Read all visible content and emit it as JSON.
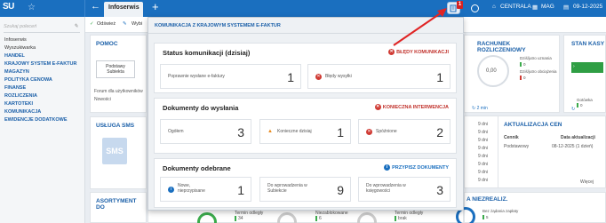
{
  "topbar": {
    "logo": "SU",
    "active_tab": "Infoserwis",
    "notification_count": "1",
    "company": "CENTRALA",
    "warehouse": "MAG",
    "date": "09-12-2025"
  },
  "sidebar": {
    "search_placeholder": "Szukaj poleceń",
    "items": [
      {
        "label": "Infoserwis"
      },
      {
        "label": "Wyszukiwarka"
      },
      {
        "label": "HANDEL"
      },
      {
        "label": "KRAJOWY SYSTEM E-FAKTUR"
      },
      {
        "label": "MAGAZYN"
      },
      {
        "label": "POLITYKA CENOWA"
      },
      {
        "label": "FINANSE"
      },
      {
        "label": "ROZLICZENIA"
      },
      {
        "label": "KARTOTEKI"
      },
      {
        "label": "KOMUNIKACJA"
      },
      {
        "label": "EWIDENCJE DODATKOWE"
      }
    ]
  },
  "toolbar": {
    "refresh": "Odśwież",
    "choose": "Wybi"
  },
  "tiles": {
    "pomoc_title": "POMOC",
    "pomoc_btn": "Podstawy Subiekta",
    "forum": "Forum dla użytkowników",
    "nowosci": "Nowości",
    "sms_title": "USŁUGA SMS",
    "sms_icon": "SMS",
    "asortyment": "ASORTYMENT DO",
    "rachunek_title": "RACHUNEK ROZLICZENIOWY",
    "rachunek_val": "0,00",
    "doliczenie_uznania": "Dziś/jutro uznania",
    "doliczenie_obciazenia": "Dziś/jutro obciążenia",
    "zero_a": "0",
    "zero_b": "0",
    "min_label": "2 min",
    "stan_title": "STAN KASY",
    "gotowka": "Gotówka",
    "gotowka_val": "0",
    "aktualizacja_title": "AKTUALIZACJA CEN",
    "cennik": "Cennik",
    "data_aktualizacji": "Data aktualizacji",
    "podstawowy": "Podstawowy",
    "data_val": "08-12-2025 (1 dzień)",
    "wiecej": "Więcej",
    "dni": [
      "9 dni",
      "9 dni",
      "9 dni",
      "9 dni",
      "9 dni",
      "9 dni",
      "9 dni",
      "9 dni"
    ],
    "niezrealiz": "A NIEZREALIZ.",
    "bez_zadania": "Bez żądania zapłaty",
    "bez_val": "5",
    "termin_a": "Termin odległy",
    "termin_a_val": "34",
    "niezablokowane": "Niezablokowane",
    "niezablokowane_val": "6",
    "termin_b": "Termin odległy",
    "brak": "brak",
    "wiecej_c": "Więc"
  },
  "modal": {
    "title": "KOMUNIKACJA Z KRAJOWYM SYSTEMEM E-FAKTUR",
    "status": {
      "title": "Status komunikacji (dzisiaj)",
      "flag": "BŁĘDY KOMUNIKACJI",
      "cells": [
        {
          "label": "Poprawnie wysłane e-faktury",
          "value": "1"
        },
        {
          "label": "Błędy wysyłki",
          "value": "1"
        }
      ]
    },
    "to_send": {
      "title": "Dokumenty do wysłania",
      "flag": "KONIECZNA INTERWENCJA",
      "cells": [
        {
          "label": "Ogółem",
          "value": "3"
        },
        {
          "label": "Konieczne dzisiaj",
          "value": "1"
        },
        {
          "label": "Spóźnione",
          "value": "2"
        }
      ]
    },
    "received": {
      "title": "Dokumenty odebrane",
      "flag": "PRZYPISZ DOKUMENTY",
      "cells": [
        {
          "label": "Nowe, nieprzypisane",
          "value": "1"
        },
        {
          "label": "Do wprowadzenia w Subiekcie",
          "value": "9"
        },
        {
          "label": "Do wprowadzenia w księgowości",
          "value": "3"
        }
      ]
    }
  },
  "colors": {
    "brand": "#1a6fbf",
    "error": "#c0302a",
    "warning": "#e8891c",
    "success": "#3bab4c"
  }
}
